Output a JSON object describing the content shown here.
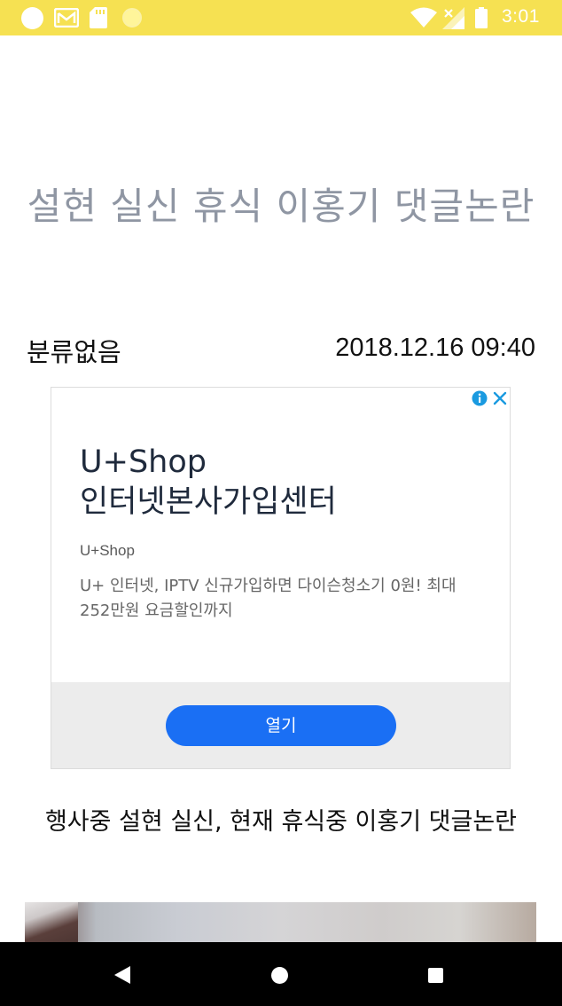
{
  "status_bar": {
    "time": "3:01",
    "background_color": "#f6e152",
    "icons": [
      "notification-circle-icon",
      "mail-icon",
      "sd-card-icon",
      "notification-dot-icon",
      "wifi-icon",
      "signal-icon",
      "battery-icon"
    ]
  },
  "article": {
    "title": "설현 실신 휴식 이홍기 댓글논란",
    "category": "분류없음",
    "date": "2018.12.16 09:40",
    "body": "행사중 설현 실신, 현재 휴식중  이홍기 댓글논란",
    "title_color": "#8f96a3"
  },
  "ad": {
    "headline_line1": "U+Shop",
    "headline_line2": "인터넷본사가입센터",
    "advertiser": "U+Shop",
    "description": "U+ 인터넷, IPTV 신규가입하면 다이슨청소기 0원! 최대 252만원 요금할인까지",
    "cta_label": "열기",
    "cta_color": "#1a6ff4",
    "accent_color": "#1a73e8",
    "icons": [
      "ad-info-icon",
      "ad-close-icon"
    ]
  },
  "nav_bar": {
    "icons": [
      "back-icon",
      "home-icon",
      "recents-icon"
    ]
  }
}
